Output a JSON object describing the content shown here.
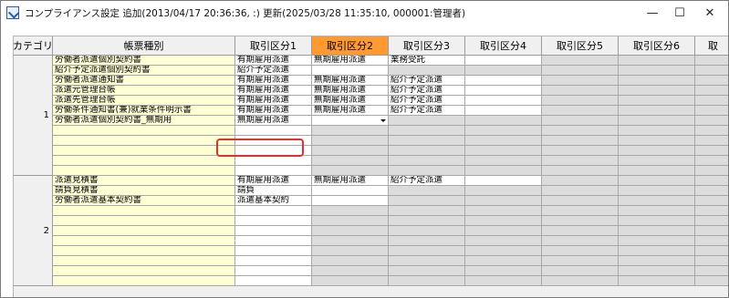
{
  "window": {
    "title": "コンプライアンス設定 追加(2013/04/17 20:36:36, :) 更新(2025/03/28 11:35:10, 000001:管理者)",
    "minimize_glyph": "—",
    "maximize_glyph": "☐",
    "close_glyph": "✕"
  },
  "headers": {
    "category": "カテゴリ",
    "doc_type": "帳票種別",
    "k1": "取引区分1",
    "k2": "取引区分2",
    "k3": "取引区分3",
    "k4": "取引区分4",
    "k5": "取引区分5",
    "k6": "取引区分6",
    "k7": "取"
  },
  "groups": [
    {
      "category": "1",
      "rows": [
        {
          "name": "労働者派遣個別契約書",
          "k1": "有期雇用派遣",
          "k2": "無期雇用派遣",
          "k3": "業務受託",
          "k4": ""
        },
        {
          "name": "紹介予定派遣個別契約書",
          "k1": "紹介予定派遣",
          "k2": "",
          "k3": "",
          "k4": ""
        },
        {
          "name": "労働者派遣通知書",
          "k1": "有期雇用派遣",
          "k2": "無期雇用派遣",
          "k3": "紹介予定派遣",
          "k4": ""
        },
        {
          "name": "派遣元管理台帳",
          "k1": "有期雇用派遣",
          "k2": "無期雇用派遣",
          "k3": "紹介予定派遣",
          "k4": ""
        },
        {
          "name": "派遣先管理台帳",
          "k1": "有期雇用派遣",
          "k2": "無期雇用派遣",
          "k3": "紹介予定派遣",
          "k4": ""
        },
        {
          "name": "労働条件通知書(兼)就業条件明示書",
          "k1": "有期雇用派遣",
          "k2": "無期雇用派遣",
          "k3": "紹介予定派遣",
          "k4": ""
        },
        {
          "name": "労働者派遣個別契約書_無期用",
          "k1": "無期雇用派遣",
          "k2": "",
          "k3": "",
          "k4": ""
        },
        {
          "name": "",
          "k1": "",
          "k2": "",
          "k3": "",
          "k4": ""
        },
        {
          "name": "",
          "k1": "",
          "k2": "",
          "k3": "",
          "k4": ""
        },
        {
          "name": "",
          "k1": "",
          "k2": "",
          "k3": "",
          "k4": ""
        },
        {
          "name": "",
          "k1": "",
          "k2": "",
          "k3": "",
          "k4": ""
        },
        {
          "name": "",
          "k1": "",
          "k2": "",
          "k3": "",
          "k4": ""
        }
      ]
    },
    {
      "category": "2",
      "rows": [
        {
          "name": "派遣見積書",
          "k1": "有期雇用派遣",
          "k2": "無期雇用派遣",
          "k3": "紹介予定派遣",
          "k4": ""
        },
        {
          "name": "請負見積書",
          "k1": "請負",
          "k2": "",
          "k3": "",
          "k4": ""
        },
        {
          "name": "労働者派遣基本契約書",
          "k1": "派遣基本契約",
          "k2": "",
          "k3": "",
          "k4": ""
        },
        {
          "name": "",
          "k1": "",
          "k2": "",
          "k3": "",
          "k4": ""
        },
        {
          "name": "",
          "k1": "",
          "k2": "",
          "k3": "",
          "k4": ""
        },
        {
          "name": "",
          "k1": "",
          "k2": "",
          "k3": "",
          "k4": ""
        },
        {
          "name": "",
          "k1": "",
          "k2": "",
          "k3": "",
          "k4": ""
        },
        {
          "name": "",
          "k1": "",
          "k2": "",
          "k3": "",
          "k4": ""
        },
        {
          "name": "",
          "k1": "",
          "k2": "",
          "k3": "",
          "k4": ""
        },
        {
          "name": "",
          "k1": "",
          "k2": "",
          "k3": "",
          "k4": ""
        },
        {
          "name": "",
          "k1": "",
          "k2": "",
          "k3": "",
          "k4": ""
        }
      ]
    }
  ],
  "colors": {
    "active_header": "#ff9a33",
    "editable_cell": "#ffffd6",
    "disabled_cell": "#dcdcdc",
    "highlight": "#e03030"
  }
}
